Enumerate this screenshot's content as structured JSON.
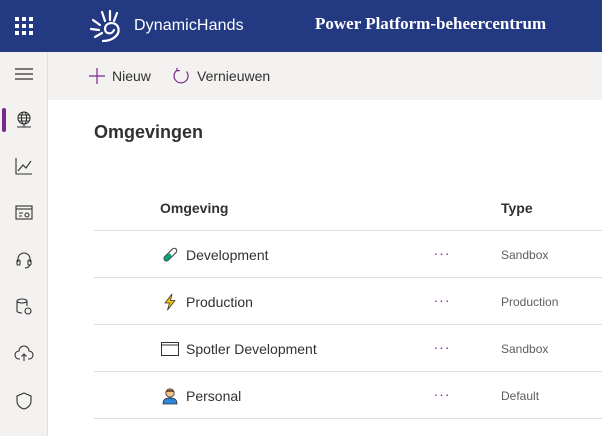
{
  "topbar": {
    "brand_text": "DynamicHands",
    "app_title": "Power Platform-beheercentrum",
    "background": "#233a82"
  },
  "leftnav": {
    "accent": "#7a2a8c",
    "items": [
      {
        "icon": "hamburger-icon"
      },
      {
        "icon": "globe-icon",
        "selected": true
      },
      {
        "icon": "analytics-icon"
      },
      {
        "icon": "resources-icon"
      },
      {
        "icon": "headset-icon"
      },
      {
        "icon": "data-integration-icon"
      },
      {
        "icon": "cloud-upload-icon"
      },
      {
        "icon": "shield-icon"
      }
    ]
  },
  "commandbar": {
    "new_label": "Nieuw",
    "refresh_label": "Vernieuwen"
  },
  "page": {
    "title": "Omgevingen"
  },
  "table": {
    "columns": {
      "environment": "Omgeving",
      "type": "Type"
    },
    "more_label": "···",
    "rows": [
      {
        "name": "Development",
        "type": "Sandbox",
        "icon": "test-tube-icon"
      },
      {
        "name": "Production",
        "type": "Production",
        "icon": "lightning-icon"
      },
      {
        "name": "Spotler Development",
        "type": "Sandbox",
        "icon": "window-icon"
      },
      {
        "name": "Personal",
        "type": "Default",
        "icon": "person-icon"
      }
    ]
  }
}
